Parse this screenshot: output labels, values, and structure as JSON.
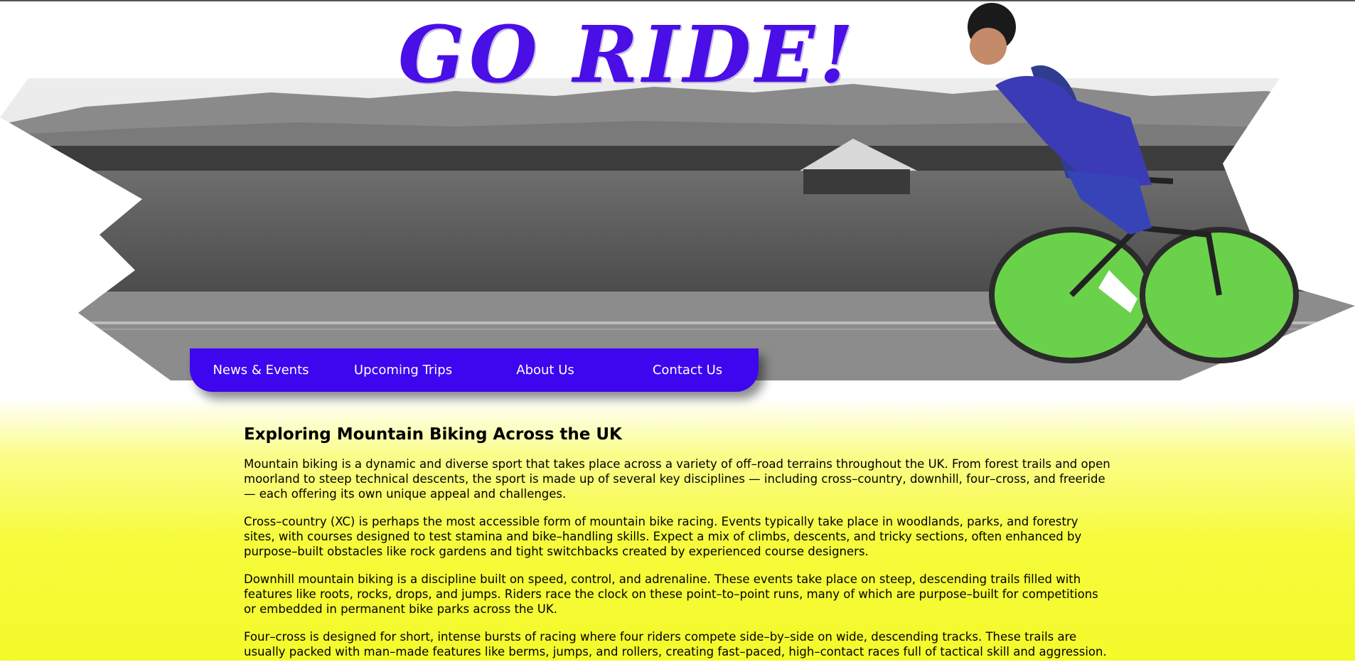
{
  "header": {
    "logo_text": "GO RIDE!"
  },
  "nav": {
    "items": [
      {
        "label": "News & Events"
      },
      {
        "label": "Upcoming Trips"
      },
      {
        "label": "About Us"
      },
      {
        "label": "Contact Us"
      }
    ]
  },
  "article": {
    "title": "Exploring Mountain Biking Across the UK",
    "paragraphs": [
      "Mountain biking is a dynamic and diverse sport that takes place across a variety of off–road terrains throughout the UK. From forest trails and open moorland to steep technical descents, the sport is made up of several key disciplines — including cross–country, downhill, four–cross, and freeride — each offering its own unique appeal and challenges.",
      "Cross–country (XC) is perhaps the most accessible form of mountain bike racing. Events typically take place in woodlands, parks, and forestry sites, with courses designed to test stamina and bike–handling skills. Expect a mix of climbs, descents, and tricky sections, often enhanced by purpose–built obstacles like rock gardens and tight switchbacks created by experienced course designers.",
      "Downhill mountain biking is a discipline built on speed, control, and adrenaline. These events take place on steep, descending trails filled with features like roots, rocks, drops, and jumps. Riders race the clock on these point–to–point runs, many of which are purpose–built for competitions or embedded in permanent bike parks across the UK.",
      "Four–cross is designed for short, intense bursts of racing where four riders compete side–by–side on wide, descending tracks. These trails are usually packed with man–made features like berms, jumps, and rollers, creating fast–paced, high–contact races full of tactical skill and aggression."
    ]
  },
  "colors": {
    "brand_purple": "#3d06ef",
    "logo_purple": "#4a0ee6",
    "background_yellow": "#f4fa2a"
  },
  "hero_image": {
    "description_icon": "cyclist-road-banner"
  }
}
